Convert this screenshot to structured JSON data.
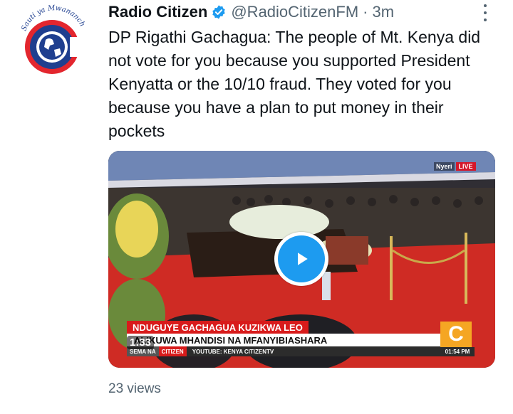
{
  "author": {
    "display_name": "Radio Citizen",
    "handle": "@RadioCitizenFM",
    "separator": "·",
    "time": "3m",
    "avatar_slogan": "Sauti ya Mwananchi",
    "verified_icon": "verified-badge-icon"
  },
  "tweet": {
    "text": "DP Rigathi Gachagua: The people of Mt. Kenya did not vote for you because you supported President Kenyatta or the 10/10 fraud. They voted for you because you have a plan to put money in their pockets"
  },
  "video": {
    "duration": "1:33",
    "location": "Nyeri",
    "live_label": "LIVE",
    "headline_top": "NDUGUYE GACHAGUA KUZIKWA LEO",
    "headline_main": "ALIKUWA MHANDISI NA MFANYIBIASHARA",
    "ticker_left": "SEMA NA",
    "ticker_brand": "CITIZEN",
    "ticker_youtube": "YOUTUBE: KENYA CITIZENTV",
    "channel_logo": "C",
    "clock": "01:54 PM",
    "play_icon": "play-icon"
  },
  "stats": {
    "views": "23 views"
  },
  "colors": {
    "accent": "#1d9bf0",
    "secondary_text": "#536471",
    "lower_third_red": "#d81b1b",
    "avatar_red": "#e3262e",
    "avatar_blue": "#1f3f8f"
  }
}
